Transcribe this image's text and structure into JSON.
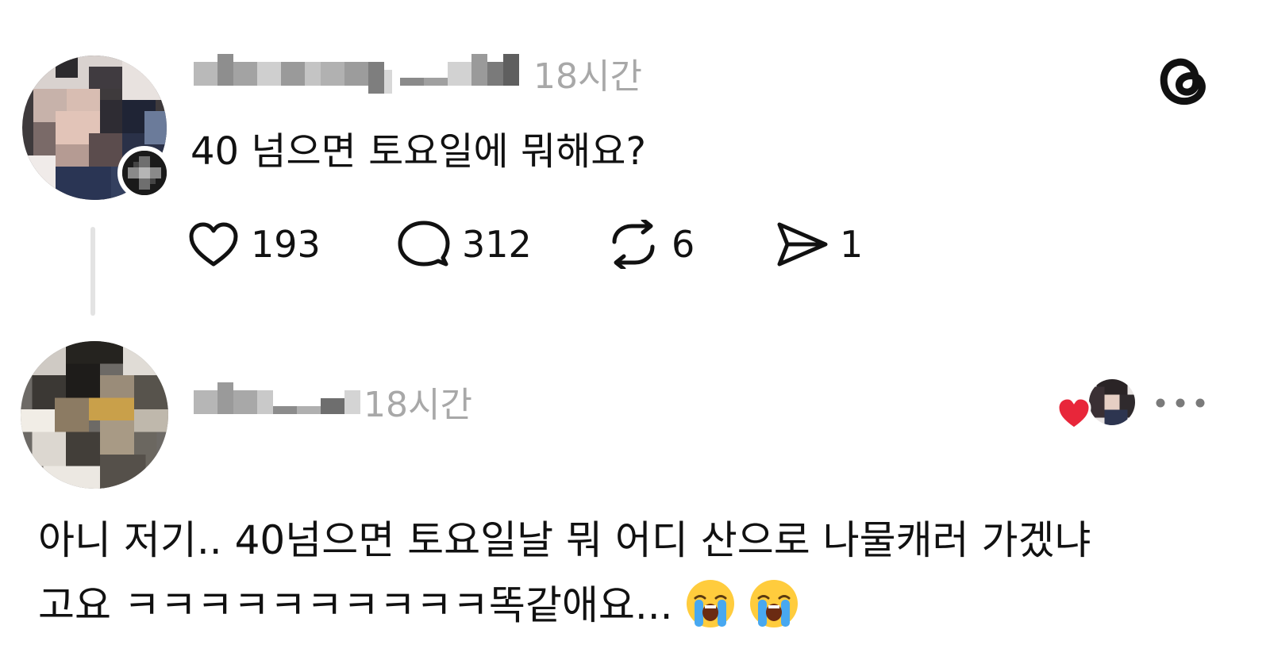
{
  "post": {
    "username": "charming__dal",
    "time": "18시간",
    "text": "40 넘으면 토요일에 뭐해요?",
    "stats": {
      "likes": "193",
      "replies": "312",
      "reposts": "6",
      "shares": "1"
    },
    "icons": {
      "app": "threads-logo-icon",
      "like": "heart-icon",
      "reply": "speech-bubble-icon",
      "repost": "repost-icon",
      "share": "send-icon",
      "follow": "plus-icon"
    }
  },
  "reply": {
    "username": "cha___",
    "time": "18시간",
    "lines": [
      "아니 저기.. 40넘으면 토요일날 뭐 어디 산으로 나물캐러 가겠냐",
      "고요 ㅋㅋㅋㅋㅋㅋㅋㅋㅋㅋ똑같애요..."
    ],
    "emojis": [
      "loudly-crying-face-emoji",
      "loudly-crying-face-emoji"
    ],
    "icons": {
      "liked_by": "heart-icon",
      "more": "more-options-icon"
    }
  },
  "colors": {
    "text": "#111111",
    "muted": "#a8a8a8",
    "like_heart": "#e8263a",
    "thread_line": "#e3e3e3"
  }
}
